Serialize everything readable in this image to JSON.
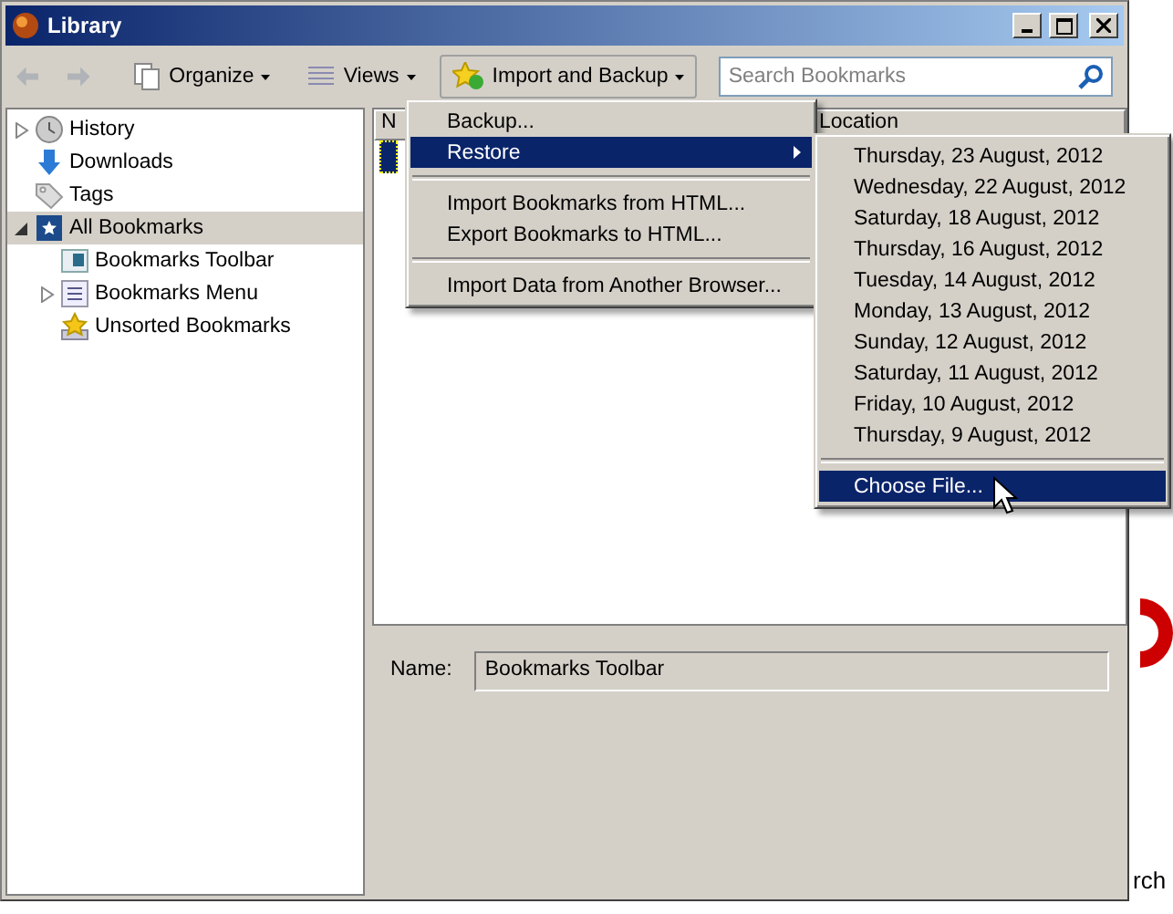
{
  "window": {
    "title": "Library"
  },
  "toolbar": {
    "organize": "Organize",
    "views": "Views",
    "import_backup": "Import and Backup",
    "search": {
      "placeholder": "Search Bookmarks"
    }
  },
  "sidebar": {
    "items": [
      {
        "label": "History",
        "expanded": false,
        "selected": false
      },
      {
        "label": "Downloads",
        "selected": false
      },
      {
        "label": "Tags",
        "selected": false
      },
      {
        "label": "All Bookmarks",
        "expanded": true,
        "selected": true,
        "children": [
          {
            "label": "Bookmarks Toolbar",
            "selected": false
          },
          {
            "label": "Bookmarks Menu",
            "expanded": false,
            "selected": false
          },
          {
            "label": "Unsorted Bookmarks",
            "selected": false
          }
        ]
      }
    ]
  },
  "table": {
    "columns": [
      "N",
      "Location"
    ]
  },
  "details": {
    "label": "Name:",
    "value": "Bookmarks Toolbar"
  },
  "import_menu": {
    "items": [
      {
        "kind": "item",
        "label": "Backup...",
        "selected": false
      },
      {
        "kind": "submenu",
        "label": "Restore",
        "selected": true
      },
      {
        "kind": "separator"
      },
      {
        "kind": "item",
        "label": "Import Bookmarks from HTML...",
        "selected": false
      },
      {
        "kind": "item",
        "label": "Export Bookmarks to HTML...",
        "selected": false
      },
      {
        "kind": "separator"
      },
      {
        "kind": "item",
        "label": "Import Data from Another Browser...",
        "selected": false
      }
    ]
  },
  "restore_menu": {
    "items": [
      {
        "kind": "item",
        "label": "Thursday, 23 August, 2012",
        "selected": false
      },
      {
        "kind": "item",
        "label": "Wednesday, 22 August, 2012",
        "selected": false
      },
      {
        "kind": "item",
        "label": "Saturday, 18 August, 2012",
        "selected": false
      },
      {
        "kind": "item",
        "label": "Thursday, 16 August, 2012",
        "selected": false
      },
      {
        "kind": "item",
        "label": "Tuesday, 14 August, 2012",
        "selected": false
      },
      {
        "kind": "item",
        "label": "Monday, 13 August, 2012",
        "selected": false
      },
      {
        "kind": "item",
        "label": "Sunday, 12 August, 2012",
        "selected": false
      },
      {
        "kind": "item",
        "label": "Saturday, 11 August, 2012",
        "selected": false
      },
      {
        "kind": "item",
        "label": "Friday, 10 August, 2012",
        "selected": false
      },
      {
        "kind": "item",
        "label": "Thursday, 9 August, 2012",
        "selected": false
      },
      {
        "kind": "separator"
      },
      {
        "kind": "item",
        "label": "Choose File...",
        "selected": true
      }
    ]
  },
  "background": {
    "button_text": "rch"
  }
}
